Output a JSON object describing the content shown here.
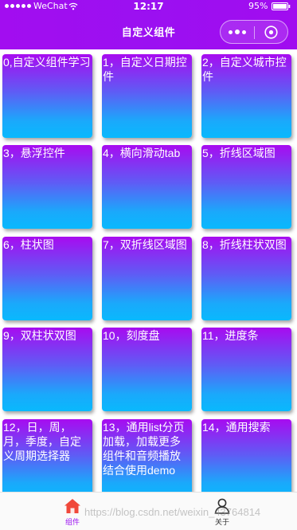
{
  "status_bar": {
    "carrier": "WeChat",
    "time": "12:17",
    "battery": "95%"
  },
  "nav": {
    "title": "自定义组件"
  },
  "grid": {
    "items": [
      {
        "label": "0,自定义组件学习"
      },
      {
        "label": "1，自定义日期控件"
      },
      {
        "label": "2，自定义城市控件"
      },
      {
        "label": "3，悬浮控件"
      },
      {
        "label": "4，横向滑动tab"
      },
      {
        "label": "5，折线区域图"
      },
      {
        "label": "6，柱状图"
      },
      {
        "label": "7，双折线区域图"
      },
      {
        "label": "8，折线柱状双图"
      },
      {
        "label": "9，双柱状双图"
      },
      {
        "label": "10，刻度盘"
      },
      {
        "label": "11，进度条"
      },
      {
        "label": "12，日，周，月，季度，自定义周期选择器"
      },
      {
        "label": "13，通用list分页加载，加载更多组件和音频播放结合使用demo"
      },
      {
        "label": "14，通用搜索"
      }
    ]
  },
  "tabbar": {
    "tabs": [
      {
        "label": "组件",
        "icon": "home-icon",
        "active": true
      },
      {
        "label": "关于",
        "icon": "user-icon",
        "active": false
      }
    ],
    "watermark": "https://blog.csdn.net/weixin_43764814"
  },
  "colors": {
    "header": "#9b10f1",
    "card_top": "#a80bf0",
    "card_bottom": "#09b9fd",
    "active_tab": "#9b10f1"
  }
}
